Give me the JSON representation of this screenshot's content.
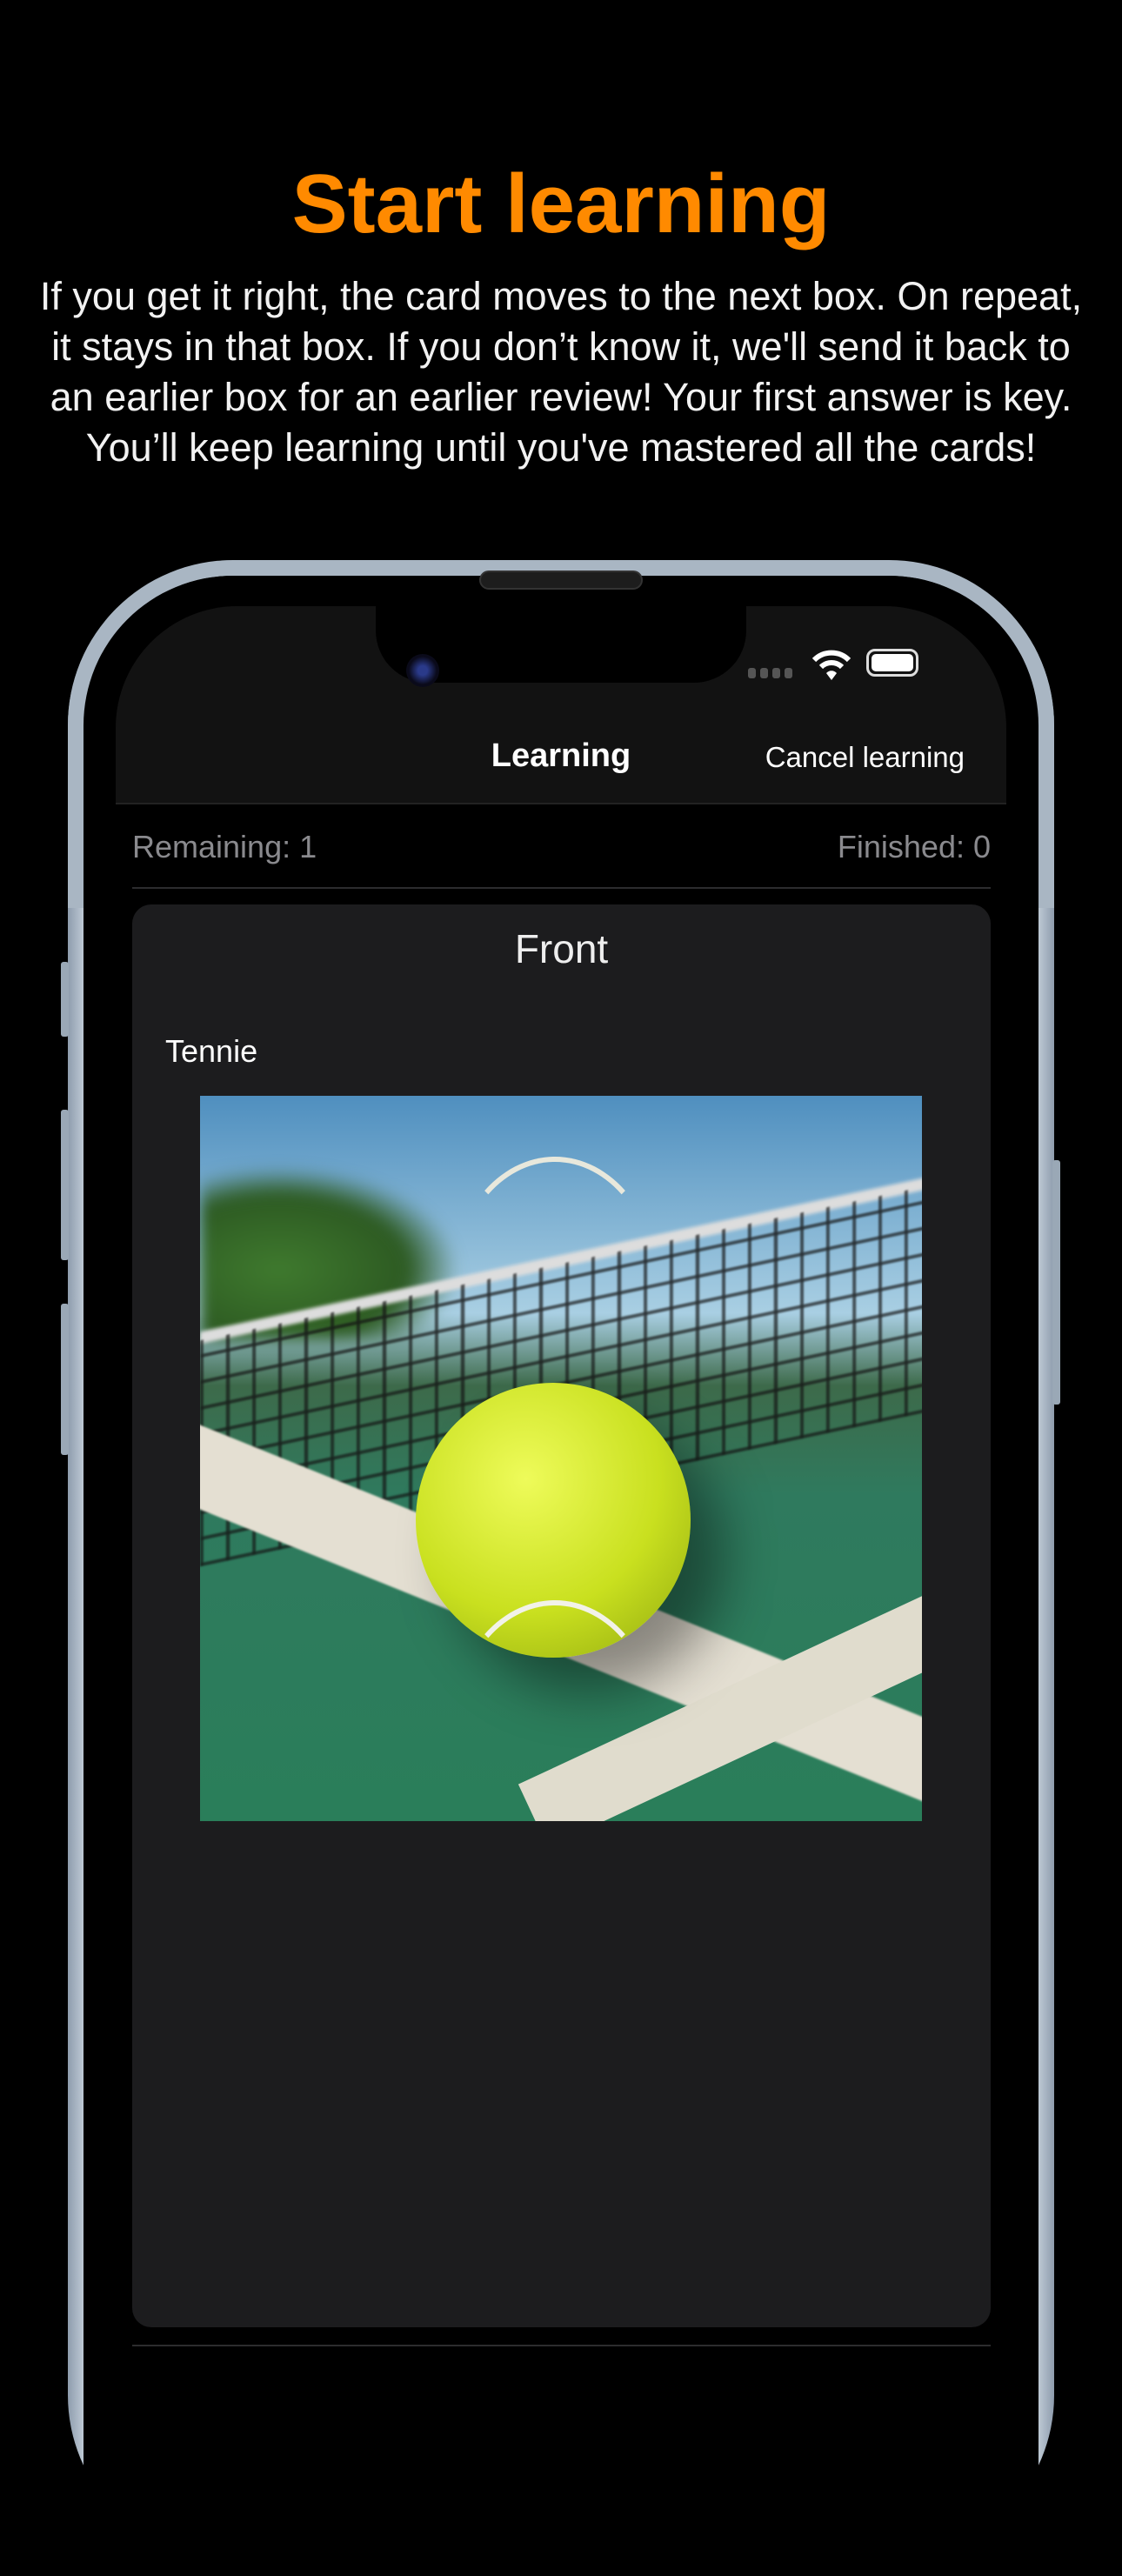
{
  "header": {
    "title": "Start learning",
    "description": "If you get it right, the card moves to the next box. On repeat, it stays in that box. If you don’t know it, we'll send it back to an earlier box for an earlier review! Your first answer is key. You’ll keep learning until you've mastered all the cards!"
  },
  "colors": {
    "accent": "#ff8a00",
    "card_bg": "#1c1c1e"
  },
  "app": {
    "nav_title": "Learning",
    "cancel_label": "Cancel learning",
    "remaining": "Remaining: 1",
    "finished": "Finished: 0",
    "card": {
      "side": "Front",
      "term": "Tennie",
      "image": "tennis-ball-on-court"
    }
  }
}
